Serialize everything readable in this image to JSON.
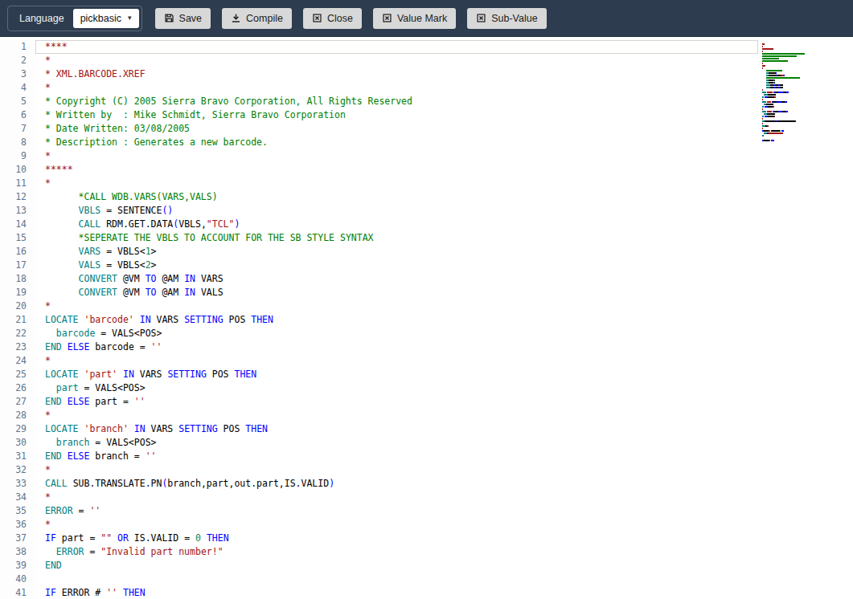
{
  "toolbar": {
    "language_label": "Language",
    "language_value": "pickbasic",
    "buttons": [
      {
        "label": "Save",
        "icon": "save-icon"
      },
      {
        "label": "Compile",
        "icon": "compile-icon"
      },
      {
        "label": "Close",
        "icon": "close-icon"
      },
      {
        "label": "Value Mark",
        "icon": "value-mark-icon"
      },
      {
        "label": "Sub-Value",
        "icon": "sub-value-icon"
      }
    ]
  },
  "icons": {
    "caret_glyph": "▾"
  },
  "colors": {
    "toolbar_bg": "#2d3c4e",
    "button_bg": "#d8d8d8",
    "line_number": "#5f7590",
    "active_line_border": "#d4d4d4",
    "tokens": {
      "d": "#000000",
      "k": "#0000ff",
      "t": "#008080",
      "s": "#a31515",
      "cg": "#008000",
      "cr": "#a31515",
      "n": "#098658"
    }
  },
  "editor": {
    "language": "pickbasic",
    "active_line": 1,
    "lines": [
      {
        "n": 1,
        "tok": [
          [
            "****",
            "cr"
          ]
        ]
      },
      {
        "n": 2,
        "tok": [
          [
            "*",
            "cr"
          ]
        ]
      },
      {
        "n": 3,
        "tok": [
          [
            "* XML.BARCODE.XREF",
            "cr"
          ]
        ]
      },
      {
        "n": 4,
        "tok": [
          [
            "*",
            "cr"
          ]
        ]
      },
      {
        "n": 5,
        "tok": [
          [
            "* Copyright (C) 2005 Sierra Bravo Corporation, All Rights Reserved",
            "cg"
          ]
        ]
      },
      {
        "n": 6,
        "tok": [
          [
            "* Written by  : Mike Schmidt, Sierra Bravo Corporation",
            "cg"
          ]
        ]
      },
      {
        "n": 7,
        "tok": [
          [
            "* Date Written: 03/08/2005",
            "cg"
          ]
        ]
      },
      {
        "n": 8,
        "tok": [
          [
            "* Description : Generates a new barcode.",
            "cg"
          ]
        ]
      },
      {
        "n": 9,
        "tok": [
          [
            "*",
            "cr"
          ]
        ]
      },
      {
        "n": 10,
        "tok": [
          [
            "*****",
            "cr"
          ]
        ]
      },
      {
        "n": 11,
        "tok": [
          [
            "*",
            "cr"
          ]
        ]
      },
      {
        "n": 12,
        "tok": [
          [
            "      ",
            "d"
          ],
          [
            "*CALL WDB.VARS(VARS,VALS)",
            "cg"
          ]
        ]
      },
      {
        "n": 13,
        "tok": [
          [
            "      ",
            "d"
          ],
          [
            "VBLS",
            "t"
          ],
          [
            " = ",
            "d"
          ],
          [
            "SENTENCE",
            "d"
          ],
          [
            "()",
            "k"
          ]
        ]
      },
      {
        "n": 14,
        "tok": [
          [
            "      ",
            "d"
          ],
          [
            "CALL",
            "t"
          ],
          [
            " RDM.GET.DATA",
            "d"
          ],
          [
            "(",
            "k"
          ],
          [
            "VBLS,",
            "d"
          ],
          [
            "\"TCL\"",
            "s"
          ],
          [
            ")",
            "k"
          ]
        ]
      },
      {
        "n": 15,
        "tok": [
          [
            "      ",
            "d"
          ],
          [
            "*SEPERATE THE VBLS TO ACCOUNT FOR THE SB STYLE SYNTAX",
            "cg"
          ]
        ]
      },
      {
        "n": 16,
        "tok": [
          [
            "      ",
            "d"
          ],
          [
            "VARS",
            "t"
          ],
          [
            " = VBLS<",
            "d"
          ],
          [
            "1",
            "n"
          ],
          [
            ">",
            "d"
          ]
        ]
      },
      {
        "n": 17,
        "tok": [
          [
            "      ",
            "d"
          ],
          [
            "VALS",
            "t"
          ],
          [
            " = VBLS<",
            "d"
          ],
          [
            "2",
            "n"
          ],
          [
            ">",
            "d"
          ]
        ]
      },
      {
        "n": 18,
        "tok": [
          [
            "      ",
            "d"
          ],
          [
            "CONVERT",
            "t"
          ],
          [
            " @VM ",
            "d"
          ],
          [
            "TO",
            "k"
          ],
          [
            " @AM ",
            "d"
          ],
          [
            "IN",
            "k"
          ],
          [
            " VARS",
            "d"
          ]
        ]
      },
      {
        "n": 19,
        "tok": [
          [
            "      ",
            "d"
          ],
          [
            "CONVERT",
            "t"
          ],
          [
            " @VM ",
            "d"
          ],
          [
            "TO",
            "k"
          ],
          [
            " @AM ",
            "d"
          ],
          [
            "IN",
            "k"
          ],
          [
            " VALS",
            "d"
          ]
        ]
      },
      {
        "n": 20,
        "tok": [
          [
            "*",
            "cr"
          ]
        ]
      },
      {
        "n": 21,
        "tok": [
          [
            "LOCATE",
            "t"
          ],
          [
            " ",
            "d"
          ],
          [
            "'barcode'",
            "s"
          ],
          [
            " ",
            "d"
          ],
          [
            "IN",
            "k"
          ],
          [
            " VARS ",
            "d"
          ],
          [
            "SETTING",
            "k"
          ],
          [
            " POS ",
            "d"
          ],
          [
            "THEN",
            "k"
          ]
        ]
      },
      {
        "n": 22,
        "tok": [
          [
            "  ",
            "d"
          ],
          [
            "barcode",
            "t"
          ],
          [
            " = VALS<POS>",
            "d"
          ]
        ]
      },
      {
        "n": 23,
        "tok": [
          [
            "END",
            "t"
          ],
          [
            " ",
            "d"
          ],
          [
            "ELSE",
            "k"
          ],
          [
            " barcode = ",
            "d"
          ],
          [
            "''",
            "s"
          ]
        ]
      },
      {
        "n": 24,
        "tok": [
          [
            "*",
            "cr"
          ]
        ]
      },
      {
        "n": 25,
        "tok": [
          [
            "LOCATE",
            "t"
          ],
          [
            " ",
            "d"
          ],
          [
            "'part'",
            "s"
          ],
          [
            " ",
            "d"
          ],
          [
            "IN",
            "k"
          ],
          [
            " VARS ",
            "d"
          ],
          [
            "SETTING",
            "k"
          ],
          [
            " POS ",
            "d"
          ],
          [
            "THEN",
            "k"
          ]
        ]
      },
      {
        "n": 26,
        "tok": [
          [
            "  ",
            "d"
          ],
          [
            "part",
            "t"
          ],
          [
            " = VALS<POS>",
            "d"
          ]
        ]
      },
      {
        "n": 27,
        "tok": [
          [
            "END",
            "t"
          ],
          [
            " ",
            "d"
          ],
          [
            "ELSE",
            "k"
          ],
          [
            " part = ",
            "d"
          ],
          [
            "''",
            "s"
          ]
        ]
      },
      {
        "n": 28,
        "tok": [
          [
            "*",
            "cr"
          ]
        ]
      },
      {
        "n": 29,
        "tok": [
          [
            "LOCATE",
            "t"
          ],
          [
            " ",
            "d"
          ],
          [
            "'branch'",
            "s"
          ],
          [
            " ",
            "d"
          ],
          [
            "IN",
            "k"
          ],
          [
            " VARS ",
            "d"
          ],
          [
            "SETTING",
            "k"
          ],
          [
            " POS ",
            "d"
          ],
          [
            "THEN",
            "k"
          ]
        ]
      },
      {
        "n": 30,
        "tok": [
          [
            "  ",
            "d"
          ],
          [
            "branch",
            "t"
          ],
          [
            " = VALS<POS>",
            "d"
          ]
        ]
      },
      {
        "n": 31,
        "tok": [
          [
            "END",
            "t"
          ],
          [
            " ",
            "d"
          ],
          [
            "ELSE",
            "k"
          ],
          [
            " branch = ",
            "d"
          ],
          [
            "''",
            "s"
          ]
        ]
      },
      {
        "n": 32,
        "tok": [
          [
            "*",
            "cr"
          ]
        ]
      },
      {
        "n": 33,
        "tok": [
          [
            "CALL",
            "t"
          ],
          [
            " SUB.TRANSLATE.PN",
            "d"
          ],
          [
            "(",
            "k"
          ],
          [
            "branch,part,out.part,IS.VALID",
            "d"
          ],
          [
            ")",
            "k"
          ]
        ]
      },
      {
        "n": 34,
        "tok": [
          [
            "*",
            "cr"
          ]
        ]
      },
      {
        "n": 35,
        "tok": [
          [
            "ERROR",
            "t"
          ],
          [
            " = ",
            "d"
          ],
          [
            "''",
            "s"
          ]
        ]
      },
      {
        "n": 36,
        "tok": [
          [
            "*",
            "cr"
          ]
        ]
      },
      {
        "n": 37,
        "tok": [
          [
            "IF",
            "k"
          ],
          [
            " part = ",
            "d"
          ],
          [
            "\"\"",
            "s"
          ],
          [
            " ",
            "d"
          ],
          [
            "OR",
            "k"
          ],
          [
            " IS.VALID = ",
            "d"
          ],
          [
            "0",
            "n"
          ],
          [
            " ",
            "d"
          ],
          [
            "THEN",
            "k"
          ]
        ]
      },
      {
        "n": 38,
        "tok": [
          [
            "  ",
            "d"
          ],
          [
            "ERROR",
            "t"
          ],
          [
            " = ",
            "d"
          ],
          [
            "\"Invalid part number!\"",
            "s"
          ]
        ]
      },
      {
        "n": 39,
        "tok": [
          [
            "END",
            "t"
          ]
        ]
      },
      {
        "n": 40,
        "tok": [
          [
            "",
            "d"
          ]
        ]
      },
      {
        "n": 41,
        "tok": [
          [
            "IF",
            "k"
          ],
          [
            " ERROR # ",
            "d"
          ],
          [
            "''",
            "s"
          ],
          [
            " ",
            "d"
          ],
          [
            "THEN",
            "k"
          ]
        ]
      }
    ]
  }
}
